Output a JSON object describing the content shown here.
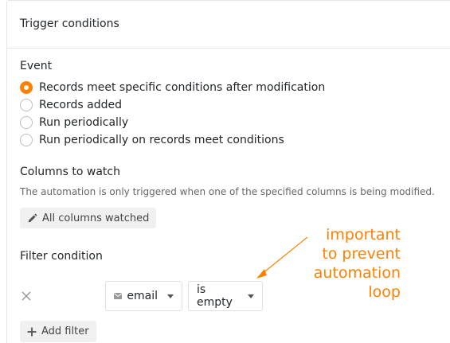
{
  "panel": {
    "title": "Trigger conditions"
  },
  "event": {
    "label": "Event",
    "options": [
      {
        "label": "Records meet specific conditions after modification",
        "selected": true
      },
      {
        "label": "Records added",
        "selected": false
      },
      {
        "label": "Run periodically",
        "selected": false
      },
      {
        "label": "Run periodically on records meet conditions",
        "selected": false
      }
    ]
  },
  "columns": {
    "label": "Columns to watch",
    "help": "The automation is only triggered when one of the specified columns is being modified.",
    "button": "All columns watched",
    "button_icon": "pencil-icon"
  },
  "filter": {
    "label": "Filter condition",
    "row": {
      "column": "email",
      "column_icon": "email-field-icon",
      "operator": "is empty"
    },
    "add_button": "Add filter"
  },
  "annotation": {
    "lines": [
      "important",
      "to prevent",
      "automation",
      "loop"
    ],
    "color": "#ff8000"
  },
  "colors": {
    "accent": "#ff8000",
    "button_bg": "#f0f0f0",
    "border": "#e6e6e6"
  }
}
